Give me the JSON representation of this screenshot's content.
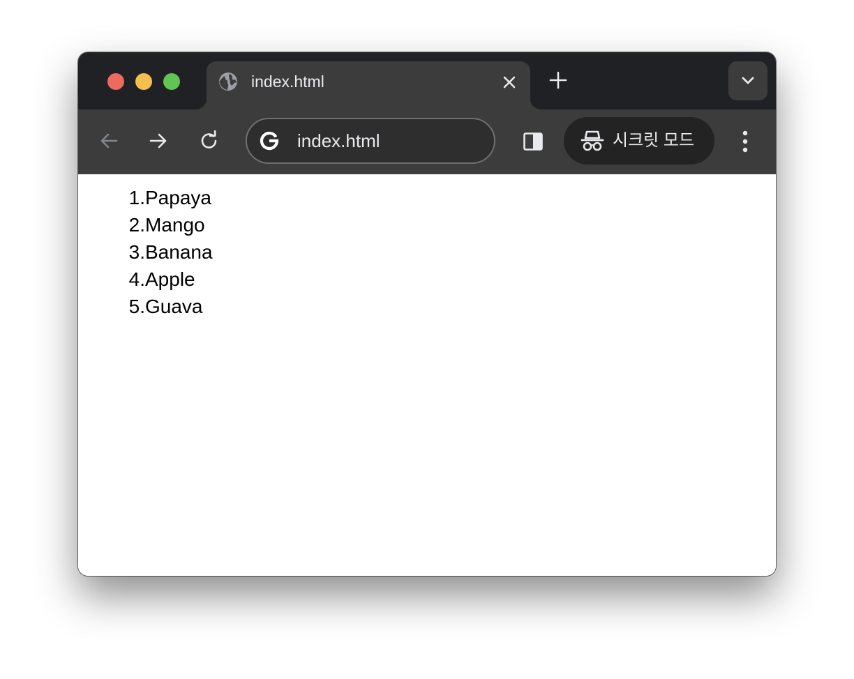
{
  "window": {
    "traffic_lights": [
      "close",
      "minimize",
      "maximize"
    ]
  },
  "tab": {
    "title": "index.html",
    "favicon_icon": "globe-icon",
    "close_icon": "close-icon"
  },
  "tabstrip": {
    "new_tab_icon": "plus-icon",
    "tab_search_icon": "chevron-down-icon"
  },
  "toolbar": {
    "back_icon": "arrow-left-icon",
    "forward_icon": "arrow-right-icon",
    "reload_icon": "reload-icon",
    "omnibox_text": "index.html",
    "omnibox_icon": "google-g-icon",
    "side_panel_icon": "side-panel-icon",
    "incognito_label": "시크릿 모드",
    "incognito_icon": "incognito-icon",
    "menu_icon": "more-vert-icon"
  },
  "page": {
    "items": [
      {
        "num": "1.",
        "name": "Papaya"
      },
      {
        "num": "2.",
        "name": "Mango"
      },
      {
        "num": "3.",
        "name": "Banana"
      },
      {
        "num": "4.",
        "name": "Apple"
      },
      {
        "num": "5.",
        "name": "Guava"
      }
    ]
  },
  "colors": {
    "tabstrip_bg": "#202124",
    "toolbar_bg": "#3c3c3c",
    "close": "#ed6a5e",
    "minimize": "#f5bf4f",
    "maximize": "#61c554"
  }
}
